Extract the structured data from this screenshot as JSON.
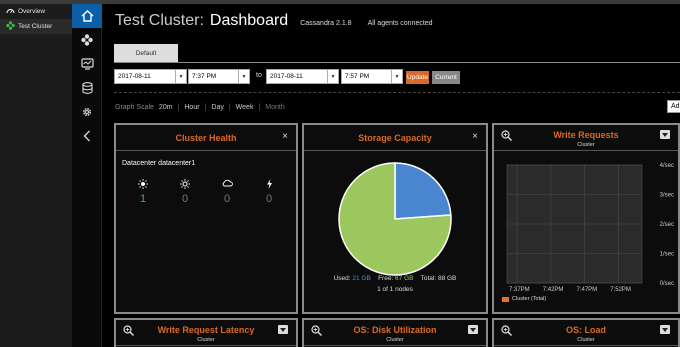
{
  "nav": {
    "overview_label": "Overview",
    "cluster_label": "Test Cluster"
  },
  "iconbar": [
    "home-icon",
    "nodes-icon",
    "monitor-icon",
    "database-icon",
    "gear-icon",
    "collapse-icon"
  ],
  "header": {
    "cluster_name": "Test Cluster:",
    "page_title": "Dashboard",
    "version": "Cassandra 2.1.8",
    "agents_status": "All agents connected"
  },
  "tabs": [
    {
      "label": "Default"
    }
  ],
  "range": {
    "from_date": "2017-08-11",
    "from_time": "7:37 PM",
    "to_label": "to",
    "to_date": "2017-08-11",
    "to_time": "7:57 PM",
    "update_label": "Update",
    "current_label": "Current"
  },
  "graph_scale": {
    "label": "Graph Scale",
    "options": [
      "20m",
      "Hour",
      "Day",
      "Week",
      "Month"
    ],
    "add_label": "Ad"
  },
  "panels": {
    "cluster_health": {
      "title": "Cluster Health",
      "datacenter": "Datacenter datacenter1",
      "counts": [
        "1",
        "0",
        "0",
        "0"
      ],
      "icons": [
        "sun-icon",
        "partly-sun-icon",
        "cloud-icon",
        "lightning-icon"
      ]
    },
    "storage_capacity": {
      "title": "Storage Capacity",
      "used_label": "Used:",
      "used_value": "21 GB",
      "free_label": "Free:",
      "free_value": "67 GB",
      "total_label": "Total:",
      "total_value": "88 GB",
      "nodes": "1 of 1 nodes"
    },
    "write_requests": {
      "title": "Write Requests",
      "subtitle": "Cluster",
      "legend": "Cluster (Total)",
      "series_color": "#e8712b"
    },
    "write_request_latency": {
      "title": "Write Request Latency",
      "subtitle": "Cluster"
    },
    "disk_utilization": {
      "title": "OS: Disk Utilization",
      "subtitle": "Cluster"
    },
    "os_load": {
      "title": "OS: Load",
      "subtitle": "Cluster"
    }
  },
  "chart_data": [
    {
      "type": "pie",
      "labels": [
        "Used",
        "Free"
      ],
      "values": [
        21,
        67
      ],
      "colors": [
        "#4a86d0",
        "#9cc65e"
      ]
    },
    {
      "type": "line",
      "title": "Write Requests",
      "x_ticks": [
        "7:37PM",
        "7:42PM",
        "7:47PM",
        "7:52PM"
      ],
      "y_ticks": [
        "0/sec",
        "1/sec",
        "2/sec",
        "3/sec",
        "4/sec"
      ],
      "ylim": [
        0,
        4
      ],
      "grid": true,
      "series": [
        {
          "name": "Cluster (Total)",
          "values": []
        }
      ]
    }
  ]
}
